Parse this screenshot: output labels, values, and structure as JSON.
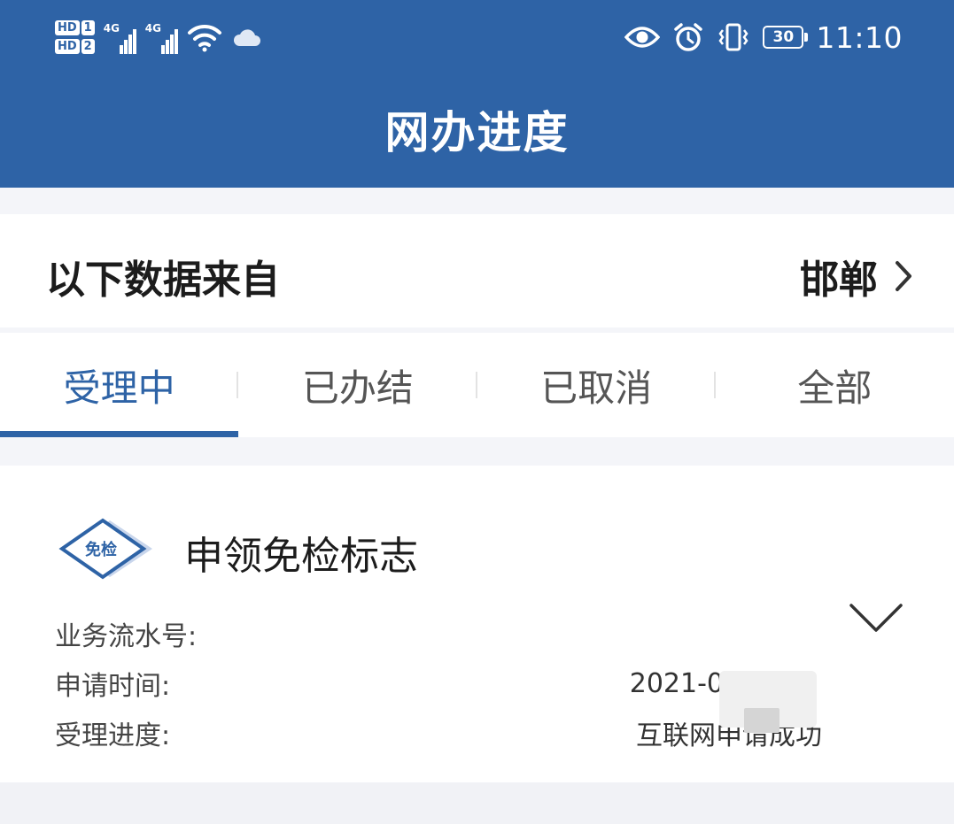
{
  "status_bar": {
    "sim1_badge": "HD",
    "sim1_num": "1",
    "sim2_badge": "HD",
    "sim2_num": "2",
    "network1": "4G",
    "network2": "4G",
    "battery_level": "30",
    "time": "11:10",
    "icons": [
      "signal-icon",
      "wifi-icon",
      "cloud-icon",
      "eye-icon",
      "alarm-icon",
      "vibrate-icon",
      "battery-icon"
    ]
  },
  "header": {
    "title": "网办进度"
  },
  "source": {
    "label": "以下数据来自",
    "city": "邯郸"
  },
  "tabs": [
    {
      "label": "受理中",
      "active": true
    },
    {
      "label": "已办结",
      "active": false
    },
    {
      "label": "已取消",
      "active": false
    },
    {
      "label": "全部",
      "active": false
    }
  ],
  "card": {
    "badge_text": "免检",
    "title": "申领免检标志",
    "rows": [
      {
        "label": "业务流水号:",
        "value": ""
      },
      {
        "label": "申请时间:",
        "value": "2021-09-0"
      },
      {
        "label": "受理进度:",
        "value": "互联网申请成功"
      }
    ]
  },
  "colors": {
    "brand": "#2e63a6",
    "background": "#f4f5f9",
    "card": "#ffffff"
  }
}
